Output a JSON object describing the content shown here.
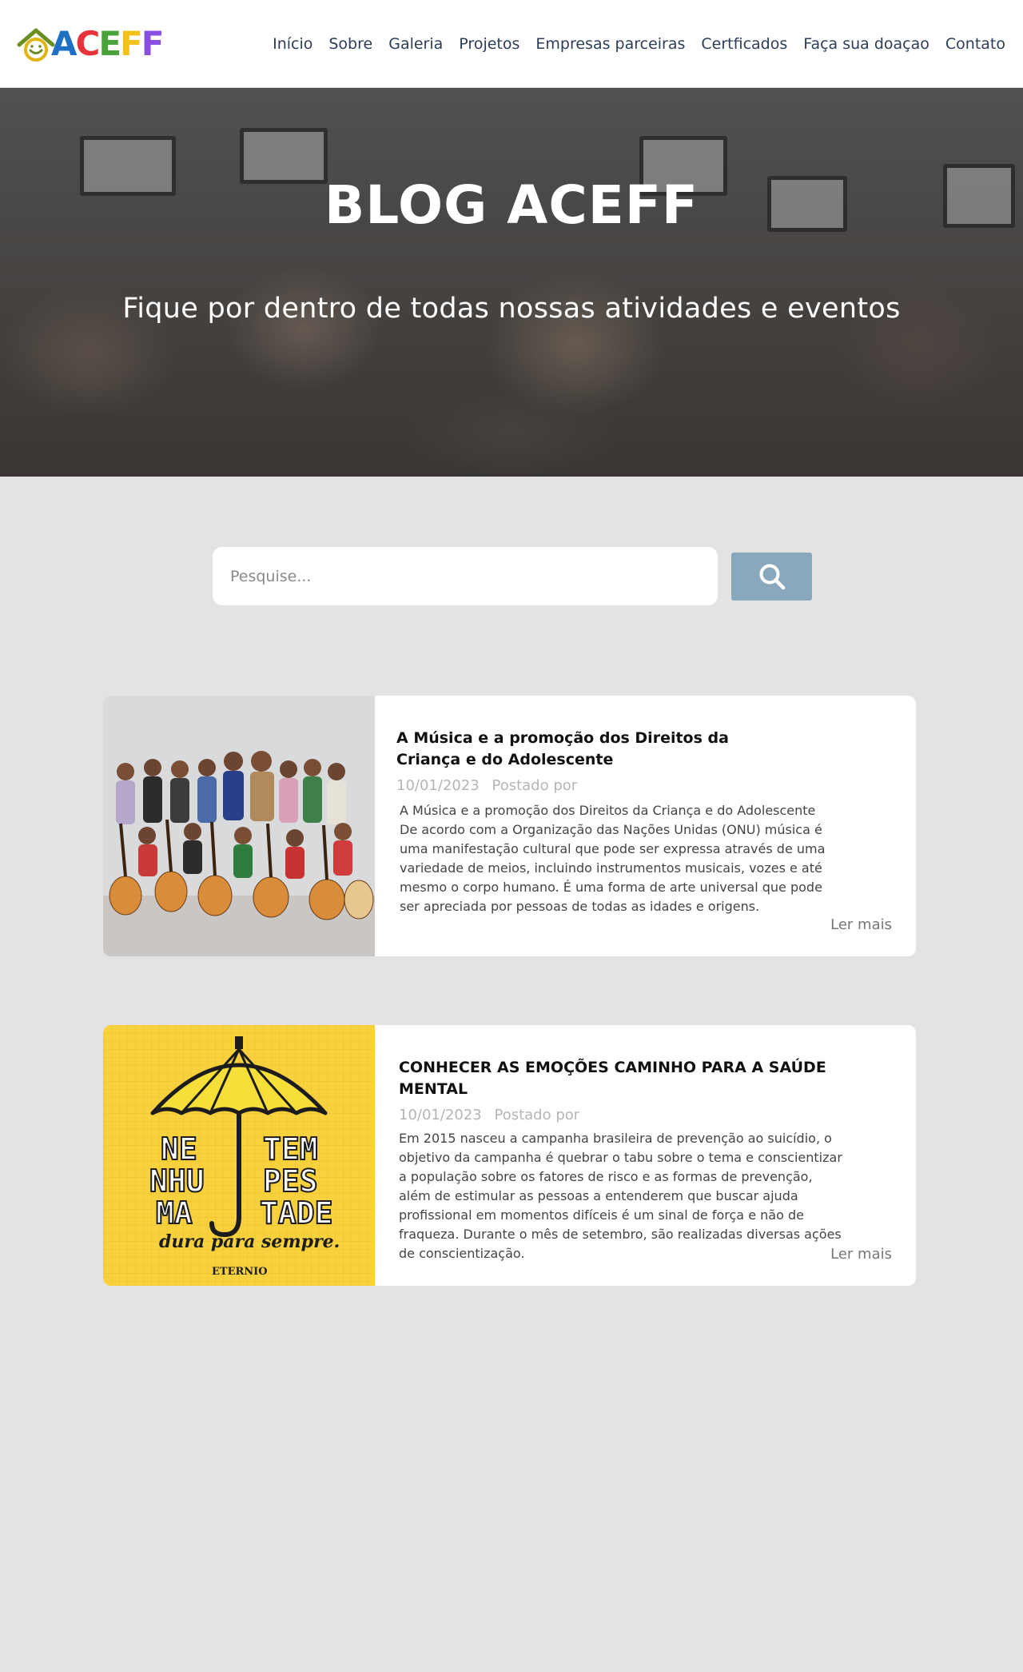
{
  "brand": {
    "logo_text": "ACEFF",
    "colors": {
      "blue": "#1f6fc4",
      "red": "#e6343a",
      "green": "#4aa33a",
      "yellow": "#f2c21a",
      "purple": "#8a4fe0",
      "house": "#6b8e23"
    }
  },
  "nav": {
    "items": [
      {
        "label": "Início"
      },
      {
        "label": "Sobre"
      },
      {
        "label": "Galeria"
      },
      {
        "label": "Projetos"
      },
      {
        "label": "Empresas parceiras"
      },
      {
        "label": "Certficados"
      },
      {
        "label": "Faça sua doaçao"
      },
      {
        "label": "Contato"
      }
    ]
  },
  "hero": {
    "title": "BLOG ACEFF",
    "subtitle": "Fique por dentro de todas nossas atividades e eventos"
  },
  "search": {
    "placeholder": "Pesquise...",
    "value": "",
    "button_icon": "search-icon",
    "button_color": "#8aa8bd"
  },
  "posts": [
    {
      "title": "A Música e a promoção dos Direitos da Criança e do Adolescente",
      "date": "10/01/2023",
      "posted_by": "Postado por",
      "excerpt": "A Música e a promoção dos Direitos da Criança e do Adolescente\nDe acordo com a Organização das Nações Unidas (ONU) música é uma manifestação cultural que pode ser expressa através de uma variedade de meios, incluindo instrumentos musicais, vozes e até mesmo o corpo humano. É uma forma de arte universal que pode ser apreciada por pessoas de todas as idades e origens.",
      "read_more": "Ler mais"
    },
    {
      "title": "CONHECER AS EMOÇÕES CAMINHO PARA A SAÚDE MENTAL",
      "date": "10/01/2023",
      "posted_by": "Postado por",
      "excerpt": "Em 2015 nasceu a campanha brasileira de prevenção ao suicídio, o objetivo da campanha é quebrar  o tabu sobre o tema  e conscientizar a população sobre os fatores de risco e as formas de prevenção, além de estimular as pessoas a entenderem que buscar ajuda profissional em momentos difíceis é um sinal de força e não de fraqueza. Durante o mês de setembro, são realizadas diversas ações de conscientização.",
      "read_more": "Ler mais",
      "image_text": {
        "left": [
          "NE",
          "NHU",
          "MA"
        ],
        "right": [
          "TEM",
          "PES",
          "TADE"
        ],
        "tagline": "dura para sempre.",
        "brand": "ETERNIO"
      }
    }
  ]
}
